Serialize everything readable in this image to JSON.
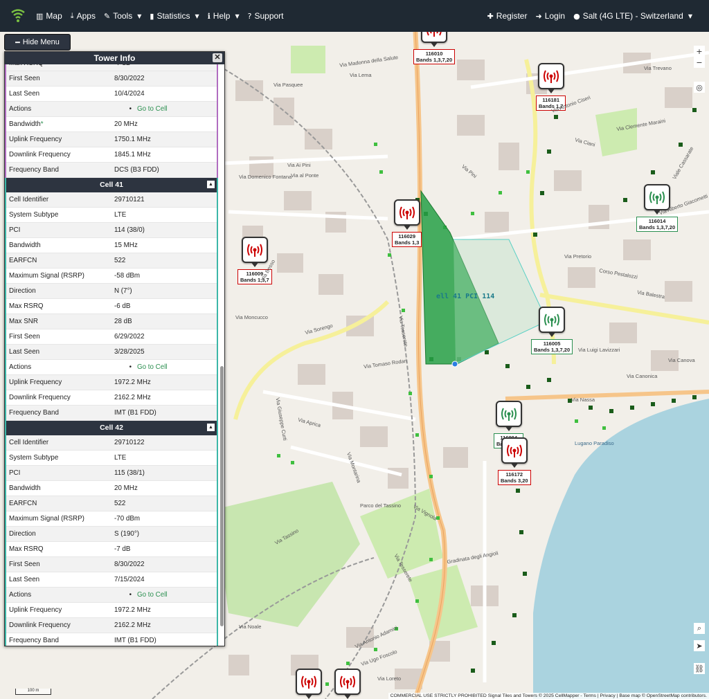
{
  "nav": {
    "items": [
      {
        "icon": "map-icon",
        "label": "Map",
        "glyph": "▥"
      },
      {
        "icon": "download-icon",
        "label": "Apps",
        "glyph": "⤓"
      },
      {
        "icon": "wrench-icon",
        "label": "Tools",
        "glyph": "✎",
        "caret": true
      },
      {
        "icon": "bar-chart-icon",
        "label": "Statistics",
        "glyph": "▮",
        "caret": true
      },
      {
        "icon": "info-icon",
        "label": "Help",
        "glyph": "ℹ",
        "caret": true
      },
      {
        "icon": "question-icon",
        "label": "Support",
        "glyph": "?"
      }
    ],
    "right": [
      {
        "icon": "user-plus-icon",
        "label": "Register",
        "glyph": "✚"
      },
      {
        "icon": "login-icon",
        "label": "Login",
        "glyph": "➜"
      },
      {
        "icon": "location-pin-icon",
        "label": "Salt (4G LTE) - Switzerland",
        "glyph": "●",
        "caret": true
      }
    ]
  },
  "hide_menu": {
    "label": "Hide Menu",
    "glyph": "━"
  },
  "panel": {
    "title": "Tower Info",
    "close": "✕",
    "partial_row": {
      "k": "Max RSRQ",
      "v": "-7 dB"
    },
    "section1_rows": [
      {
        "k": "First Seen",
        "v": "8/30/2022"
      },
      {
        "k": "Last Seen",
        "v": "10/4/2024"
      },
      {
        "k": "Actions",
        "v": "Go to Cell",
        "link": true
      },
      {
        "k": "Bandwidth*",
        "v": "20 MHz"
      },
      {
        "k": "Uplink Frequency",
        "v": "1750.1 MHz"
      },
      {
        "k": "Downlink Frequency",
        "v": "1845.1 MHz"
      },
      {
        "k": "Frequency Band",
        "v": "DCS (B3 FDD)"
      }
    ],
    "cells": [
      {
        "title": "Cell 41",
        "rows": [
          {
            "k": "Cell Identifier",
            "v": "29710121"
          },
          {
            "k": "System Subtype",
            "v": "LTE"
          },
          {
            "k": "PCI",
            "v": "114 (38/0)"
          },
          {
            "k": "Bandwidth",
            "v": "15 MHz"
          },
          {
            "k": "EARFCN",
            "v": "522"
          },
          {
            "k": "Maximum Signal (RSRP)",
            "v": "-58 dBm"
          },
          {
            "k": "Direction",
            "v": "N (7°)"
          },
          {
            "k": "Max RSRQ",
            "v": "-6 dB"
          },
          {
            "k": "Max SNR",
            "v": "28 dB"
          },
          {
            "k": "First Seen",
            "v": "6/29/2022"
          },
          {
            "k": "Last Seen",
            "v": "3/28/2025"
          },
          {
            "k": "Actions",
            "v": "Go to Cell",
            "link": true
          },
          {
            "k": "Uplink Frequency",
            "v": "1972.2 MHz"
          },
          {
            "k": "Downlink Frequency",
            "v": "2162.2 MHz"
          },
          {
            "k": "Frequency Band",
            "v": "IMT (B1 FDD)"
          }
        ]
      },
      {
        "title": "Cell 42",
        "rows": [
          {
            "k": "Cell Identifier",
            "v": "29710122"
          },
          {
            "k": "System Subtype",
            "v": "LTE"
          },
          {
            "k": "PCI",
            "v": "115 (38/1)"
          },
          {
            "k": "Bandwidth",
            "v": "20 MHz"
          },
          {
            "k": "EARFCN",
            "v": "522"
          },
          {
            "k": "Maximum Signal (RSRP)",
            "v": "-70 dBm"
          },
          {
            "k": "Direction",
            "v": "S (190°)"
          },
          {
            "k": "Max RSRQ",
            "v": "-7 dB"
          },
          {
            "k": "First Seen",
            "v": "8/30/2022"
          },
          {
            "k": "Last Seen",
            "v": "7/15/2024"
          },
          {
            "k": "Actions",
            "v": "Go to Cell",
            "link": true
          },
          {
            "k": "Uplink Frequency",
            "v": "1972.2 MHz"
          },
          {
            "k": "Downlink Frequency",
            "v": "2162.2 MHz"
          },
          {
            "k": "Frequency Band",
            "v": "IMT (B1 FDD)"
          }
        ]
      }
    ]
  },
  "map": {
    "sector_label": "ell 41 PCI 114",
    "towers": [
      {
        "id": "116010",
        "bands": "Bands 1,3,7,20",
        "color": "red"
      },
      {
        "id": "116181",
        "bands": "Bands 1,7",
        "color": "red"
      },
      {
        "id": "116029",
        "bands": "Bands 1,3",
        "color": "red"
      },
      {
        "id": "116009",
        "bands": "Bands 1,3,7",
        "color": "red"
      },
      {
        "id": "116014",
        "bands": "Bands 1,3,7,20",
        "color": "green"
      },
      {
        "id": "116005",
        "bands": "Bands 1,3,7,20",
        "color": "green"
      },
      {
        "id": "116004",
        "bands": "Bands 1,3",
        "color": "green"
      },
      {
        "id": "116172",
        "bands": "Bands 3,20",
        "color": "red"
      }
    ],
    "streets": [
      "Via Madonna della Salute",
      "Via Pasquee",
      "Via Lema",
      "Via Pini",
      "Via Ai Pini",
      "Via Domenico Fontana",
      "Via al Ponte",
      "Via Sorengo",
      "Via Moncucco",
      "Via Tesserete",
      "Via Besso",
      "Via Aprica",
      "Via Tomaso Rodari",
      "Via Simen",
      "Via Giuseppe Curti",
      "Via Montarina",
      "Via Canonica",
      "Via Nassa",
      "Via Cattedrale",
      "Via Pretorio",
      "Corso Pestalozzi",
      "Via Balestra",
      "Viale Cassarate",
      "Via Trevano",
      "Via Ciani",
      "Via Antonio Ciseri",
      "Via Alberto Giacometti",
      "Via Clemente Maraini",
      "Gradinata degli Angioli",
      "Via Tesserete",
      "Via Antonio Adamini",
      "Via Noale",
      "Via Tassino",
      "Via Canova",
      "Via Luigi Lavizzari",
      "Via Loreto",
      "Via Vignola",
      "Via Ugo Foscolo",
      "Parco del Tassino",
      "Lugano Paradiso"
    ],
    "attribution": "COMMERCIAL USE STRICTLY PROHIBITED Signal Tiles and Towers © 2025 CellMapper - Terms | Privacy | Base map © OpenStreetMap contributors.",
    "scale": "100 m",
    "zoom_in": "+",
    "zoom_out": "−"
  }
}
